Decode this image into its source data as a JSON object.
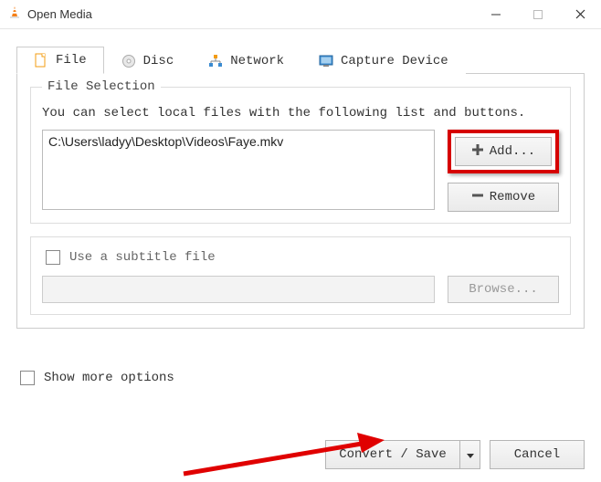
{
  "window": {
    "title": "Open Media"
  },
  "tabs": {
    "file": "File",
    "disc": "Disc",
    "network": "Network",
    "capture": "Capture Device"
  },
  "file_selection": {
    "group_title": "File Selection",
    "hint": "You can select local files with the following list and buttons.",
    "selected_file": "C:\\Users\\ladyy\\Desktop\\Videos\\Faye.mkv",
    "add_label": "Add...",
    "remove_label": "Remove"
  },
  "subtitle": {
    "checkbox_label": "Use a subtitle file",
    "browse_label": "Browse..."
  },
  "footer": {
    "more_options": "Show more options",
    "convert_label": "Convert / Save",
    "cancel_label": "Cancel"
  }
}
